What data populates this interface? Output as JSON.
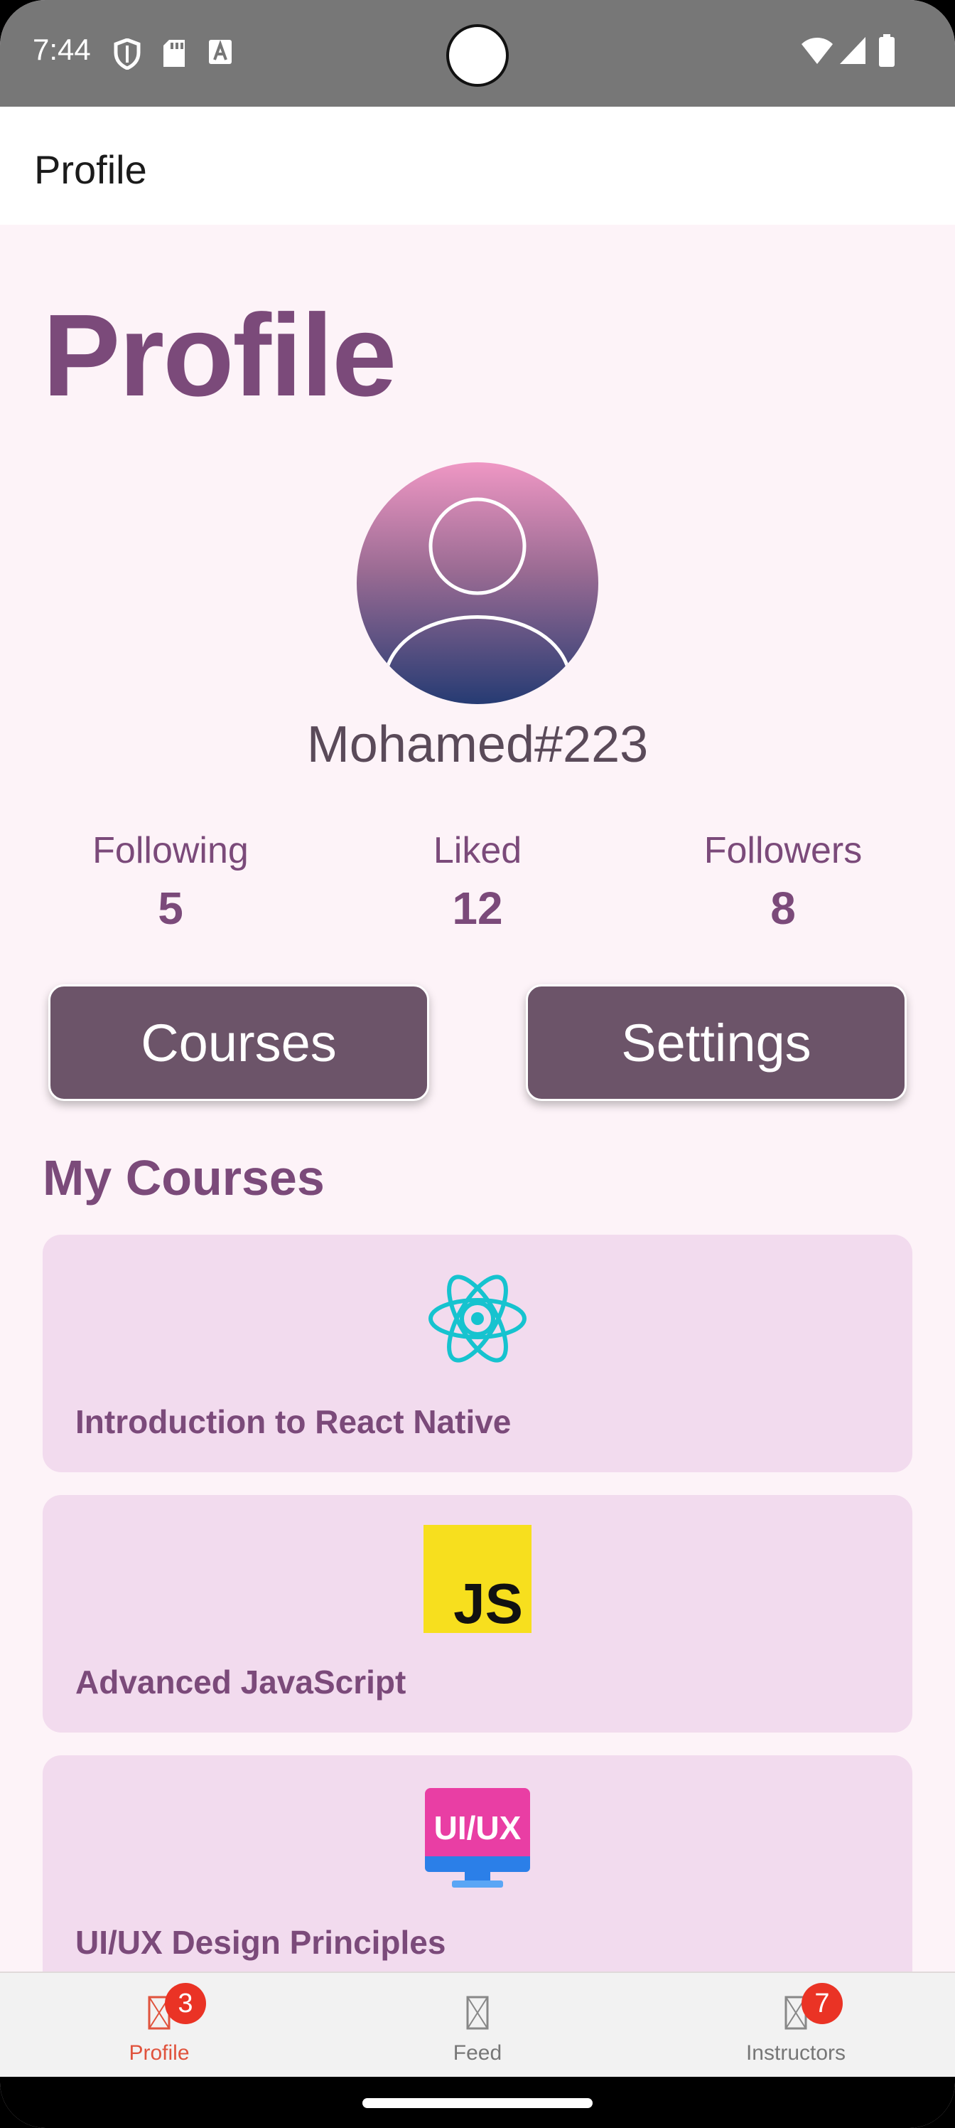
{
  "status_bar": {
    "time": "7:44",
    "left_icons": [
      "shield-icon",
      "sd-card-icon",
      "font-a-icon"
    ],
    "right_icons": [
      "wifi-icon",
      "signal-icon",
      "battery-icon"
    ]
  },
  "header": {
    "title": "Profile"
  },
  "page": {
    "title": "Profile"
  },
  "profile": {
    "avatar_icon": "person-icon",
    "username": "Mohamed#223",
    "stats": [
      {
        "label": "Following",
        "value": "5"
      },
      {
        "label": "Liked",
        "value": "12"
      },
      {
        "label": "Followers",
        "value": "8"
      }
    ]
  },
  "actions": {
    "courses_label": "Courses",
    "settings_label": "Settings"
  },
  "courses": {
    "title": "My Courses",
    "items": [
      {
        "name": "Introduction to React Native",
        "icon": "react-logo-icon"
      },
      {
        "name": "Advanced JavaScript",
        "icon": "js-logo-icon"
      },
      {
        "name": "UI/UX Design Principles",
        "icon": "uiux-monitor-icon",
        "logo_text": "UI/UX"
      }
    ]
  },
  "tabs": [
    {
      "label": "Profile",
      "badge": "3",
      "active": true
    },
    {
      "label": "Feed",
      "badge": null,
      "active": false
    },
    {
      "label": "Instructors",
      "badge": "7",
      "active": false
    }
  ],
  "colors": {
    "accent": "#7b4a7a",
    "button": "#6c5469",
    "card": "#f2dbee",
    "background": "#fdf3f8",
    "active_tab": "#e0533d",
    "badge": "#ea3325"
  }
}
